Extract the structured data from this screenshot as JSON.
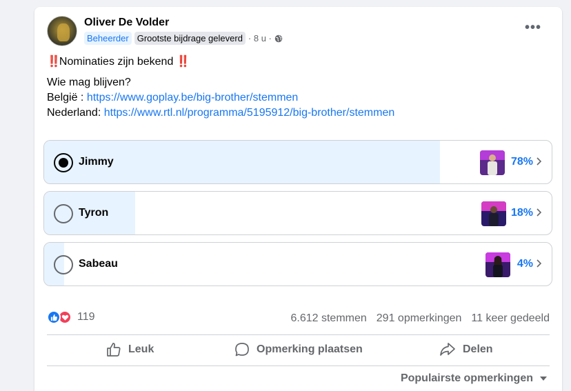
{
  "post": {
    "author": "Oliver De Volder",
    "badge_admin": "Beheerder",
    "badge_top": "Grootste bijdrage geleverd",
    "time": "· 8 u ·",
    "title_text": "Nominaties zijn bekend",
    "bang": "‼️",
    "line1": "Wie mag blijven?",
    "be_prefix": "België : ",
    "be_link": "https://www.goplay.be/big-brother/stemmen",
    "nl_prefix": "Nederland: ",
    "nl_link": "https://www.rtl.nl/programma/5195912/big-brother/stemmen"
  },
  "poll": {
    "options": [
      {
        "label": "Jimmy",
        "percent_text": "78%",
        "percent": 78,
        "selected": true
      },
      {
        "label": "Tyron",
        "percent_text": "18%",
        "percent": 18,
        "selected": false
      },
      {
        "label": "Sabeau",
        "percent_text": "4%",
        "percent": 4,
        "selected": false
      }
    ]
  },
  "footer": {
    "reaction_count": "119",
    "votes": "6.612 stemmen",
    "comments": "291 opmerkingen",
    "shares": "11 keer gedeeld",
    "like_label": "Leuk",
    "comment_label": "Opmerking plaatsen",
    "share_label": "Delen",
    "sort_label": "Populairste opmerkingen"
  },
  "colors": {
    "accent": "#1877f2",
    "fill": "#e7f3ff",
    "love": "#f33e58"
  }
}
